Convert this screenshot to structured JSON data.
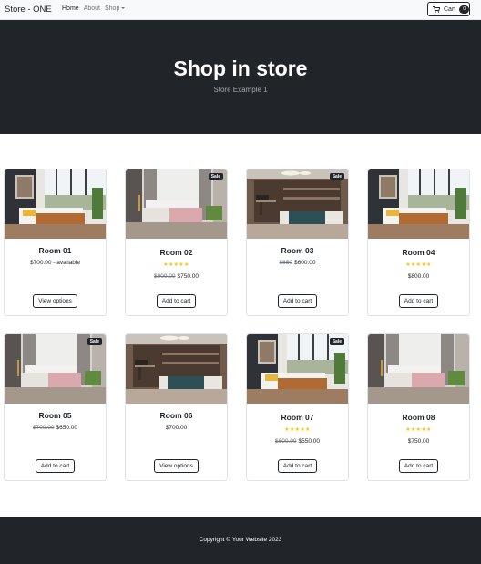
{
  "navbar": {
    "brand": "Store - ONE",
    "links": [
      {
        "label": "Home",
        "active": true
      },
      {
        "label": "About",
        "active": false
      },
      {
        "label": "Shop",
        "active": false,
        "dropdown": true
      }
    ],
    "cart": {
      "label": "Cart",
      "count": "0",
      "icon": "cart-icon"
    }
  },
  "header": {
    "title": "Shop in store",
    "subtitle": "Store Example 1"
  },
  "products": [
    {
      "name": "Room 01",
      "price": "$700.00 - available",
      "old_price": "",
      "rating": 0,
      "sale": false,
      "button": "View options",
      "image": "bedroom-bright"
    },
    {
      "name": "Room 02",
      "price": "$750.00",
      "old_price": "$900.00",
      "rating": 5,
      "sale": true,
      "button": "Add to cart",
      "image": "bedroom-curtain"
    },
    {
      "name": "Room 03",
      "price": "$600.00",
      "old_price": "$650",
      "rating": 0,
      "sale": true,
      "button": "Add to cart",
      "image": "bedroom-dark"
    },
    {
      "name": "Room 04",
      "price": "$800.00",
      "old_price": "",
      "rating": 5,
      "sale": false,
      "button": "Add to cart",
      "image": "bedroom-bright"
    },
    {
      "name": "Room 05",
      "price": "$650.00",
      "old_price": "$700.00",
      "rating": 0,
      "sale": true,
      "button": "Add to cart",
      "image": "bedroom-curtain"
    },
    {
      "name": "Room 06",
      "price": "$700.00",
      "old_price": "",
      "rating": 0,
      "sale": false,
      "button": "View options",
      "image": "bedroom-dark"
    },
    {
      "name": "Room 07",
      "price": "$550.00",
      "old_price": "$600.00",
      "rating": 5,
      "sale": true,
      "button": "Add to cart",
      "image": "bedroom-bright"
    },
    {
      "name": "Room 08",
      "price": "$750.00",
      "old_price": "",
      "rating": 5,
      "sale": false,
      "button": "Add to cart",
      "image": "bedroom-curtain"
    }
  ],
  "sale_label": "Sale",
  "footer": {
    "copyright": "Copyright © Your Website 2023"
  },
  "colors": {
    "dark": "#212529",
    "star": "#ffc107",
    "navbar_bg": "#f8f9fa"
  }
}
